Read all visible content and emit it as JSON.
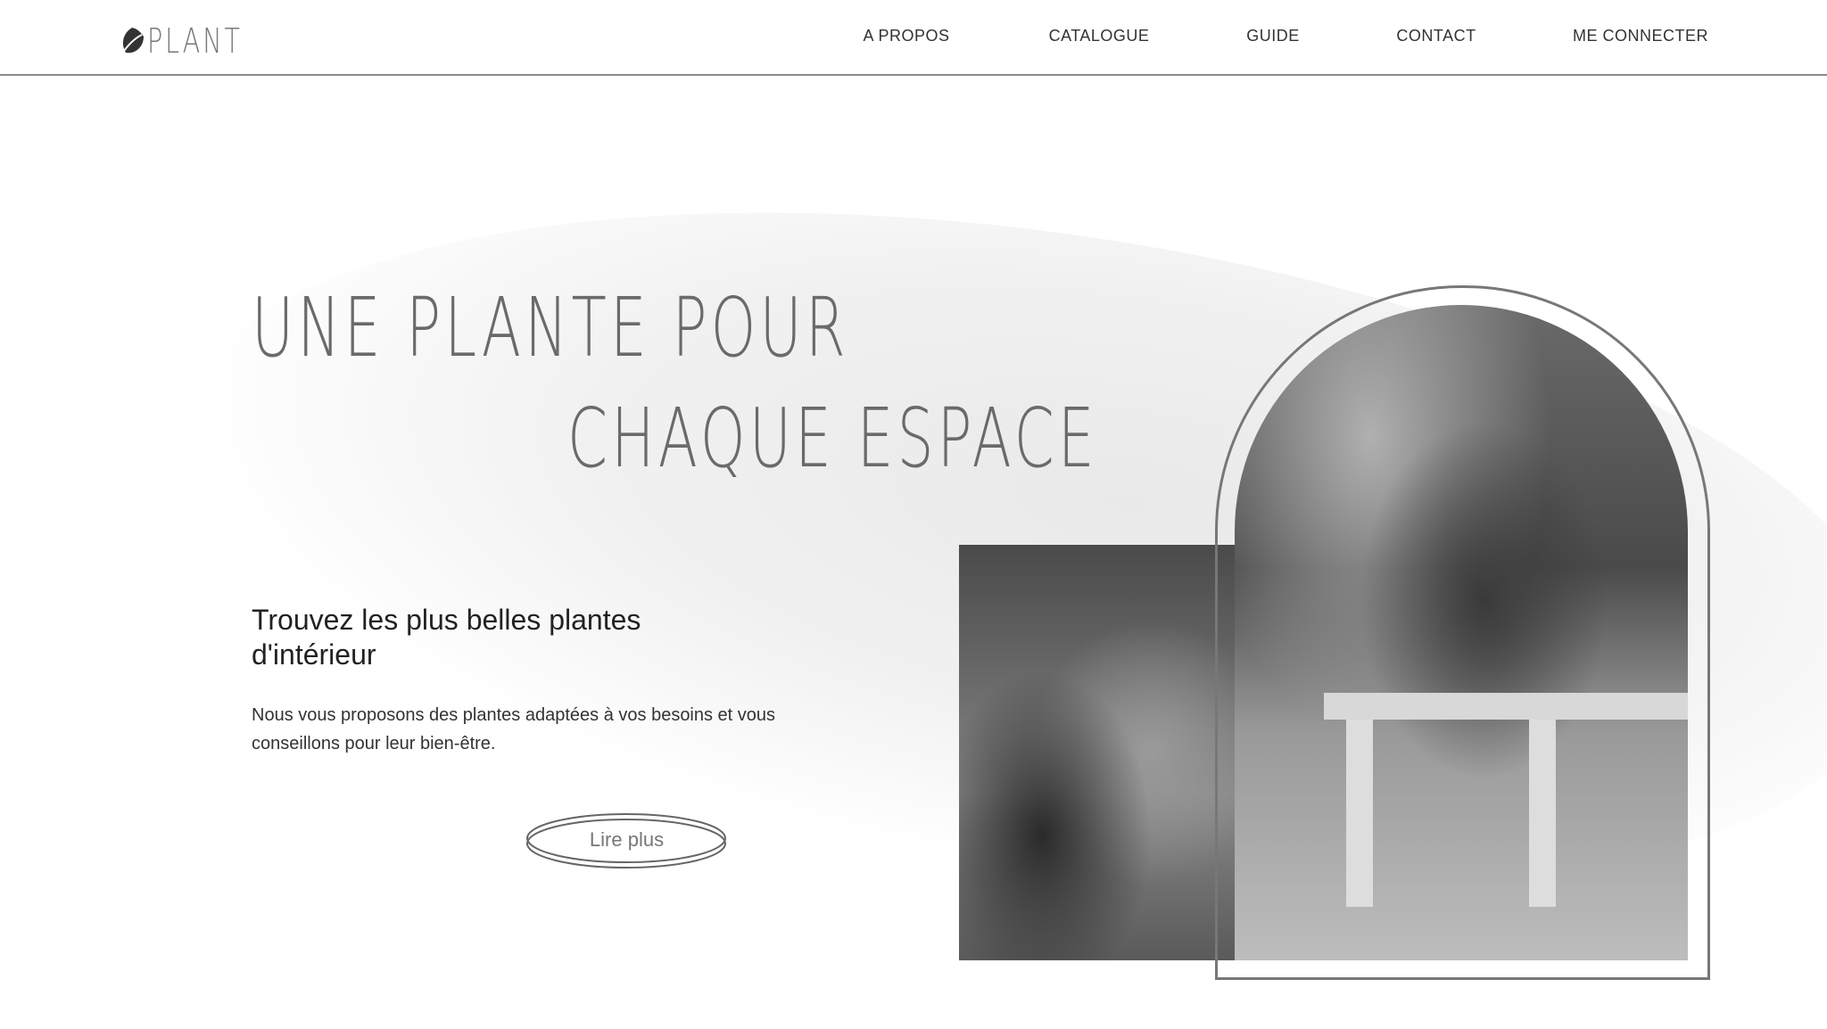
{
  "header": {
    "logo_text": "PLANT",
    "nav": [
      "A PROPOS",
      "CATALOGUE",
      "GUIDE",
      "CONTACT",
      "ME CONNECTER"
    ]
  },
  "hero": {
    "title_line1": "UNE PLANTE POUR",
    "title_line2": "CHAQUE ESPACE",
    "subtitle": "Trouvez les plus belles plantes d'intérieur",
    "description": "Nous vous proposons des plantes adaptées à vos besoins et vous conseillons pour leur bien-être.",
    "cta_label": "Lire plus"
  },
  "colors": {
    "text": "#222222",
    "title": "#6a6a6a",
    "accent_gray": "#777777"
  }
}
